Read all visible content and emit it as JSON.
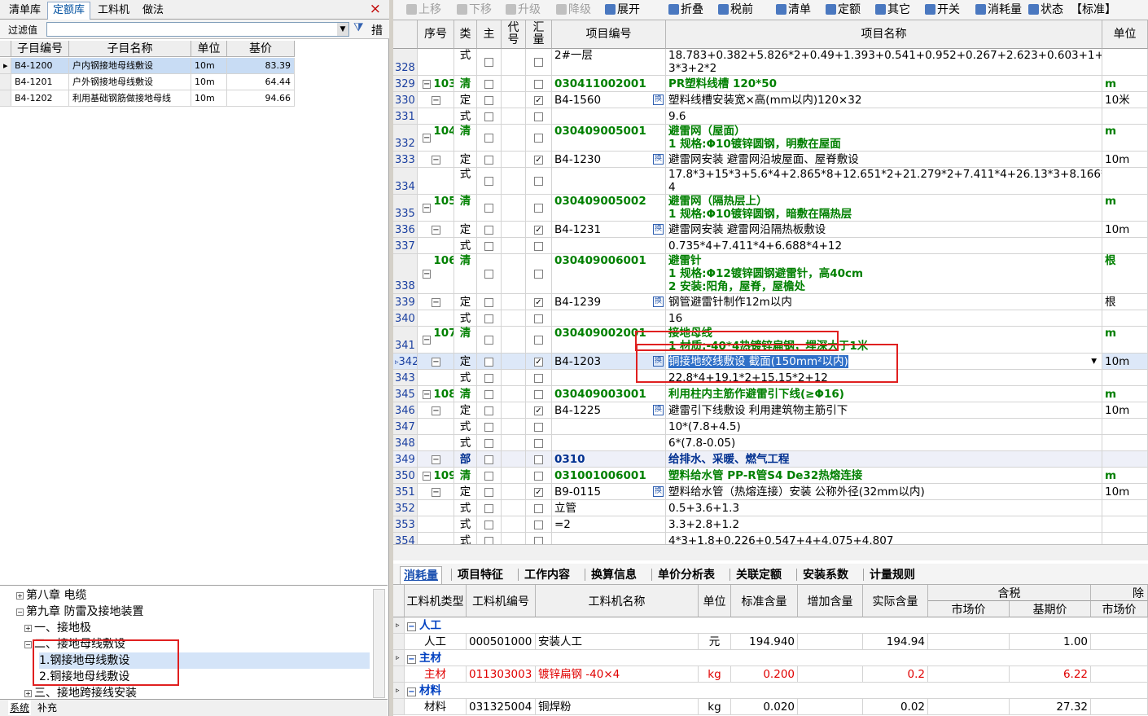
{
  "left": {
    "tabs": [
      "清单库",
      "定额库",
      "工料机",
      "做法"
    ],
    "close": "×",
    "filter_label": "过滤值",
    "filter_value": "",
    "filter_button": "措",
    "sub_headers": [
      "子目编号",
      "子目名称",
      "单位",
      "基价"
    ],
    "sub_rows": [
      {
        "code": "B4-1200",
        "name": "户内钢接地母线敷设",
        "unit": "10m",
        "price": "83.39"
      },
      {
        "code": "B4-1201",
        "name": "户外钢接地母线敷设",
        "unit": "10m",
        "price": "64.44"
      },
      {
        "code": "B4-1202",
        "name": "利用基础钢筋做接地母线",
        "unit": "10m",
        "price": "94.66"
      }
    ],
    "tree": [
      "第八章  电缆",
      "第九章  防雷及接地装置",
      "一、接地极",
      "二、接地母线敷设",
      "1.钢接地母线敷设",
      "2.铜接地母线敷设",
      "三、接地跨接线安装"
    ],
    "bottom_tabs": [
      "系统",
      "补充"
    ]
  },
  "toolbar": [
    "上移",
    "下移",
    "升级",
    "降级",
    "展开",
    "折叠",
    "税前",
    "清单",
    "定额",
    "其它",
    "开关",
    "消耗量",
    "状态",
    "【标准】"
  ],
  "grid": {
    "headers": [
      "序号",
      "类",
      "主",
      "代号",
      "汇量",
      "项目编号",
      "项目名称",
      "单位"
    ],
    "rows": [
      {
        "rn": "328",
        "seq": "",
        "type": "式",
        "sum": false,
        "code": "2#一层",
        "name": "18.783+0.382+5.826*2+0.49+1.393+0.541+0.952+0.267+2.623+0.603+1+1.",
        "name2": "3*3+2*2",
        "unit": "",
        "style": "f"
      },
      {
        "rn": "329",
        "seq": "103",
        "type": "清",
        "sum": false,
        "code": "030411002001",
        "name": "PR塑料线槽 120*50",
        "unit": "m",
        "style": "q"
      },
      {
        "rn": "330",
        "seq": "",
        "type": "定",
        "sum": true,
        "code": "B4-1560",
        "name": "塑料线槽安装宽×高(mm以内)120×32",
        "unit": "10米",
        "style": "d"
      },
      {
        "rn": "331",
        "seq": "",
        "type": "式",
        "sum": false,
        "code": "",
        "name": "9.6",
        "unit": "",
        "style": "f"
      },
      {
        "rn": "332",
        "seq": "104",
        "type": "清",
        "sum": false,
        "code": "030409005001",
        "name": "避雷网（屋面）",
        "name2": "1 规格:Φ10镀锌圆钢，明敷在屋面",
        "unit": "m",
        "style": "q"
      },
      {
        "rn": "333",
        "seq": "",
        "type": "定",
        "sum": true,
        "code": "B4-1230",
        "name": "避雷网安装 避雷网沿坡屋面、屋脊敷设",
        "unit": "10m",
        "style": "d"
      },
      {
        "rn": "334",
        "seq": "",
        "type": "式",
        "sum": false,
        "code": "",
        "name": "17.8*3+15*3+5.6*4+2.865*8+12.651*2+21.279*2+7.411*4+26.13*3+8.166*",
        "name2": "4",
        "unit": "",
        "style": "f"
      },
      {
        "rn": "335",
        "seq": "105",
        "type": "清",
        "sum": false,
        "code": "030409005002",
        "name": "避雷网（隔热层上）",
        "name2": "1 规格:Φ10镀锌圆钢，暗敷在隔热层",
        "unit": "m",
        "style": "q"
      },
      {
        "rn": "336",
        "seq": "",
        "type": "定",
        "sum": true,
        "code": "B4-1231",
        "name": "避雷网安装 避雷网沿隔热板敷设",
        "unit": "10m",
        "style": "d"
      },
      {
        "rn": "337",
        "seq": "",
        "type": "式",
        "sum": false,
        "code": "",
        "name": "0.735*4+7.411*4+6.688*4+12",
        "unit": "",
        "style": "f"
      },
      {
        "rn": "338",
        "seq": "106",
        "type": "清",
        "sum": false,
        "code": "030409006001",
        "name": "避雷针",
        "name2": "1 规格:Φ12镀锌圆钢避雷针，高40cm",
        "name3": "2 安装:阳角，屋脊，屋檐处",
        "unit": "根",
        "style": "q"
      },
      {
        "rn": "339",
        "seq": "",
        "type": "定",
        "sum": true,
        "code": "B4-1239",
        "name": "钢管避雷针制作12m以内",
        "unit": "根",
        "style": "d"
      },
      {
        "rn": "340",
        "seq": "",
        "type": "式",
        "sum": false,
        "code": "",
        "name": "16",
        "unit": "",
        "style": "f"
      },
      {
        "rn": "341",
        "seq": "107",
        "type": "清",
        "sum": false,
        "code": "030409002001",
        "name": "接地母线",
        "name2": "1 材质:-40*4热镀锌扁钢，埋深大于1米",
        "unit": "m",
        "style": "q"
      },
      {
        "rn": "342",
        "seq": "",
        "type": "定",
        "sum": true,
        "code": "B4-1203",
        "name": "铜接地绞线敷设  截面(150mm²以内)",
        "unit": "10m",
        "style": "cur"
      },
      {
        "rn": "343",
        "seq": "",
        "type": "式",
        "sum": false,
        "code": "",
        "name": "22.8*4+19.1*2+15.15*2+12",
        "unit": "",
        "style": "f"
      },
      {
        "rn": "345",
        "seq": "108",
        "type": "清",
        "sum": false,
        "code": "030409003001",
        "name": "利用柱内主筋作避雷引下线(≥Φ16)",
        "unit": "m",
        "style": "q"
      },
      {
        "rn": "346",
        "seq": "",
        "type": "定",
        "sum": true,
        "code": "B4-1225",
        "name": "避雷引下线敷设 利用建筑物主筋引下",
        "unit": "10m",
        "style": "d"
      },
      {
        "rn": "347",
        "seq": "",
        "type": "式",
        "sum": false,
        "code": "",
        "name": "10*(7.8+4.5)",
        "unit": "",
        "style": "f"
      },
      {
        "rn": "348",
        "seq": "",
        "type": "式",
        "sum": false,
        "code": "",
        "name": "6*(7.8-0.05)",
        "unit": "",
        "style": "f"
      },
      {
        "rn": "349",
        "seq": "",
        "type": "部",
        "sum": false,
        "code": "0310",
        "name": "给排水、采暖、燃气工程",
        "unit": "",
        "style": "bu"
      },
      {
        "rn": "350",
        "seq": "109",
        "type": "清",
        "sum": false,
        "code": "031001006001",
        "name": "塑料给水管  PP-R管S4  De32热熔连接",
        "unit": "m",
        "style": "q"
      },
      {
        "rn": "351",
        "seq": "",
        "type": "定",
        "sum": true,
        "code": "B9-0115",
        "name": "塑料给水管（热熔连接）安装 公称外径(32mm以内)",
        "unit": "10m",
        "style": "d"
      },
      {
        "rn": "352",
        "seq": "",
        "type": "式",
        "sum": false,
        "code": "立管",
        "name": "0.5+3.6+1.3",
        "unit": "",
        "style": "f"
      },
      {
        "rn": "353",
        "seq": "",
        "type": "式",
        "sum": false,
        "code": "=2",
        "name": "3.3+2.8+1.2",
        "unit": "",
        "style": "f"
      },
      {
        "rn": "354",
        "seq": "",
        "type": "式",
        "sum": false,
        "code": "",
        "name": "4*3+1.8+0.226+0.547+4+4.075+4.807",
        "unit": "",
        "style": "f"
      }
    ],
    "huan": "换"
  },
  "bottom_tabs": [
    "消耗量",
    "项目特征",
    "工作内容",
    "换算信息",
    "单价分析表",
    "关联定额",
    "安装系数",
    "计量规则"
  ],
  "res": {
    "headers": [
      "工料机类型",
      "工料机编号",
      "工料机名称",
      "单位",
      "标准含量",
      "增加含量",
      "实际含量"
    ],
    "group1": "含税",
    "group1_sub": [
      "市场价",
      "基期价"
    ],
    "group2": "除",
    "group2_sub": [
      "市场价"
    ],
    "rows": [
      {
        "kind": "cat",
        "type": "人工"
      },
      {
        "kind": "row",
        "type": "人工",
        "code": "000501000",
        "name": "安装人工",
        "unit": "元",
        "std": "194.940",
        "add": "",
        "act": "194.94",
        "market": "",
        "base": "1.00",
        "red": false
      },
      {
        "kind": "cat",
        "type": "主材"
      },
      {
        "kind": "row",
        "type": "主材",
        "code": "011303003",
        "name": "镀锌扁钢 -40×4",
        "unit": "kg",
        "std": "0.200",
        "add": "",
        "act": "0.2",
        "market": "",
        "base": "6.22",
        "red": true
      },
      {
        "kind": "cat",
        "type": "材料"
      },
      {
        "kind": "row",
        "type": "材料",
        "code": "031325004",
        "name": "铜焊粉",
        "unit": "kg",
        "std": "0.020",
        "add": "",
        "act": "0.02",
        "market": "",
        "base": "27.32",
        "red": false
      }
    ]
  }
}
